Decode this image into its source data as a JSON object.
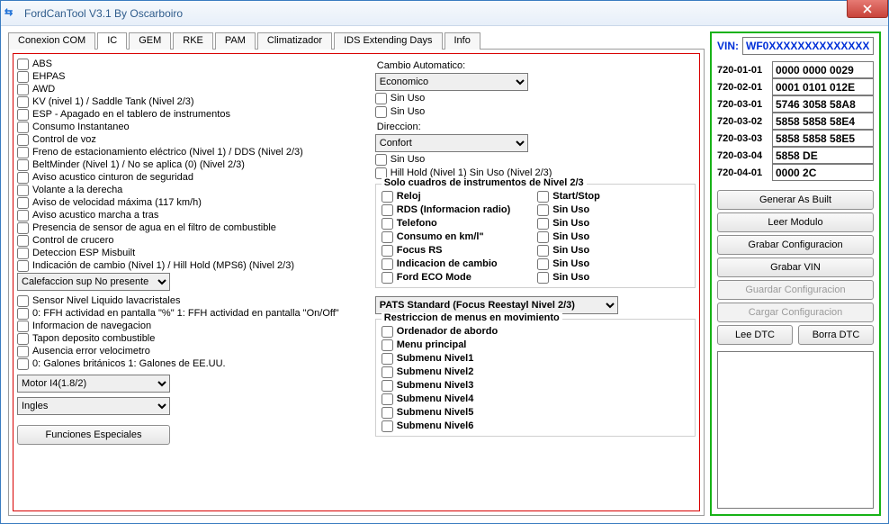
{
  "window": {
    "title": "FordCanTool V3.1 By Oscarboiro"
  },
  "tabs": [
    "Conexion COM",
    "IC",
    "GEM",
    "RKE",
    "PAM",
    "Climatizador",
    "IDS Extending Days",
    "Info"
  ],
  "active_tab": 1,
  "left_checks": [
    "ABS",
    "EHPAS",
    "AWD",
    "KV (nivel 1) / Saddle Tank (Nivel 2/3)",
    "ESP - Apagado en el tablero de instrumentos",
    "Consumo Instantaneo",
    "Control de voz",
    "Freno de estacionamiento eléctrico (Nivel 1) / DDS (Nivel 2/3)",
    "BeltMinder (Nivel 1) / No se aplica (0) (Nivel 2/3)",
    "Aviso acustico cinturon de seguridad",
    "Volante a la derecha",
    "Aviso de velocidad máxima (117 km/h)",
    "Aviso acustico marcha a tras",
    "Presencia de sensor de agua en el filtro de combustible",
    "Control de crucero",
    "Deteccion ESP Misbuilt",
    "Indicación de cambio (Nivel 1) / Hill Hold (MPS6) (Nivel 2/3)"
  ],
  "heat_select": "Calefaccion sup No presente",
  "left_checks2": [
    "Sensor Nivel Liquido lavacristales",
    "0: FFH actividad en  pantalla \"%\" 1: FFH actividad en pantalla \"On/Off\"",
    "Informacion de navegacion",
    "Tapon deposito combustible",
    "Ausencia error velocimetro",
    "0: Galones británicos 1: Galones de EE.UU."
  ],
  "engine_select": "Motor I4(1.8/2)",
  "lang_select": "Ingles",
  "fe_btn": "Funciones Especiales",
  "r_labels": {
    "cambio": "Cambio Automatico:",
    "direccion": "Direccion:"
  },
  "cambio_select": "Economico",
  "cambio_chk": [
    "Sin Uso",
    "Sin Uso"
  ],
  "direccion_select": "Confort",
  "direccion_chk": [
    "Sin Uso",
    "Hill Hold (Nivel 1) Sin Uso (Nivel 2/3)"
  ],
  "group1": {
    "title": "Solo cuadros de instrumentos de Nivel 2/3",
    "left": [
      "Reloj",
      "RDS (Informacion radio)",
      "Telefono",
      "Consumo en km/l\"",
      "Focus RS",
      "Indicacion de cambio",
      "Ford ECO Mode"
    ],
    "right": [
      "Start/Stop",
      "Sin Uso",
      "Sin Uso",
      "Sin Uso",
      "Sin Uso",
      "Sin Uso",
      "Sin Uso"
    ]
  },
  "pats_select": "PATS Standard (Focus Reestayl Nivel 2/3)",
  "group2": {
    "title": "Restriccion de menus en movimiento",
    "items": [
      "Ordenador de abordo",
      "Menu principal",
      "Submenu Nivel1",
      "Submenu Nivel2",
      "Submenu Nivel3",
      "Submenu Nivel4",
      "Submenu Nivel5",
      "Submenu Nivel6"
    ]
  },
  "side": {
    "vin_label": "VIN:",
    "vin_value": "WF0XXXXXXXXXXXXXX",
    "rows": [
      {
        "id": "720-01-01",
        "val": "0000 0000 0029"
      },
      {
        "id": "720-02-01",
        "val": "0001 0101 012E"
      },
      {
        "id": "720-03-01",
        "val": "5746 3058 58A8"
      },
      {
        "id": "720-03-02",
        "val": "5858 5858 58E4"
      },
      {
        "id": "720-03-03",
        "val": "5858 5858 58E5"
      },
      {
        "id": "720-03-04",
        "val": "5858 DE"
      },
      {
        "id": "720-04-01",
        "val": "0000 2C"
      }
    ],
    "btns": {
      "gen": "Generar As Built",
      "leer": "Leer Modulo",
      "grabarc": "Grabar Configuracion",
      "grabarv": "Grabar VIN",
      "guardar": "Guardar Configuracion",
      "cargar": "Cargar Configuracion",
      "leedtc": "Lee DTC",
      "borradtc": "Borra DTC"
    }
  }
}
